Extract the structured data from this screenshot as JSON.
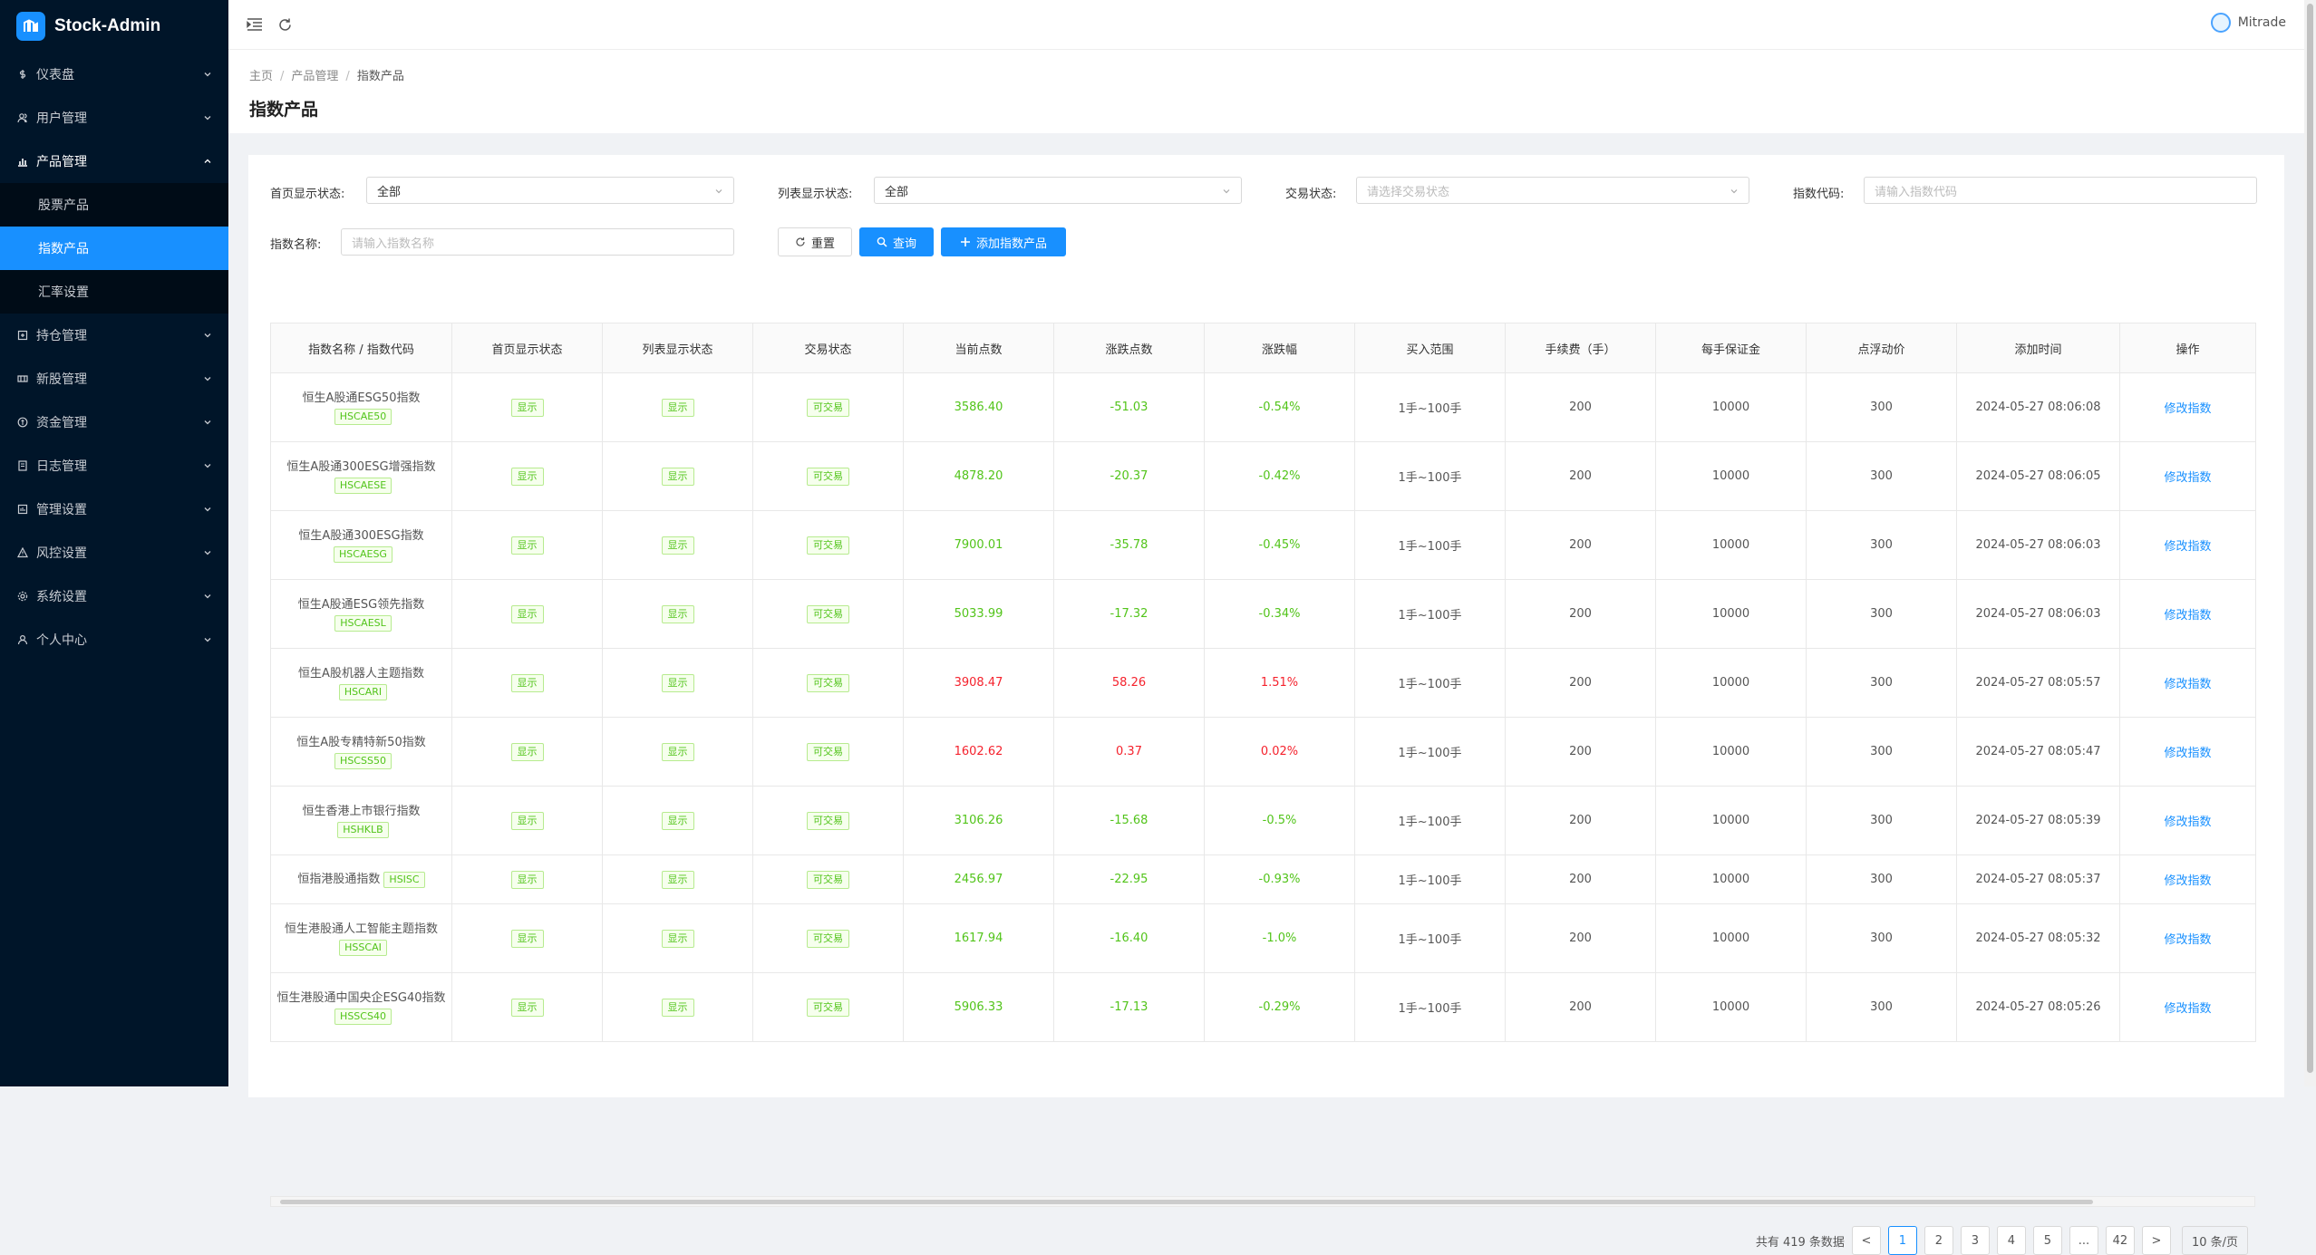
{
  "app": {
    "title": "Stock-Admin",
    "user": "Mitrade"
  },
  "sidebar": {
    "items": [
      {
        "label": "仪表盘"
      },
      {
        "label": "用户管理"
      },
      {
        "label": "产品管理"
      },
      {
        "label": "持仓管理"
      },
      {
        "label": "新股管理"
      },
      {
        "label": "资金管理"
      },
      {
        "label": "日志管理"
      },
      {
        "label": "管理设置"
      },
      {
        "label": "风控设置"
      },
      {
        "label": "系统设置"
      },
      {
        "label": "个人中心"
      }
    ],
    "sub_items": [
      {
        "label": "股票产品"
      },
      {
        "label": "指数产品"
      },
      {
        "label": "汇率设置"
      }
    ]
  },
  "breadcrumb": {
    "home": "主页",
    "parent": "产品管理",
    "current": "指数产品"
  },
  "page_title": "指数产品",
  "filters": {
    "home_display_label": "首页显示状态:",
    "home_display_value": "全部",
    "list_display_label": "列表显示状态:",
    "list_display_value": "全部",
    "trade_status_label": "交易状态:",
    "trade_status_placeholder": "请选择交易状态",
    "index_code_label": "指数代码:",
    "index_code_placeholder": "请输入指数代码",
    "index_name_label": "指数名称:",
    "index_name_placeholder": "请输入指数名称",
    "reset_label": "重置",
    "search_label": "查询",
    "add_label": "添加指数产品"
  },
  "table": {
    "headers": [
      "指数名称 / 指数代码",
      "首页显示状态",
      "列表显示状态",
      "交易状态",
      "当前点数",
      "涨跌点数",
      "涨跌幅",
      "买入范围",
      "手续费（手）",
      "每手保证金",
      "点浮动价",
      "添加时间",
      "操作"
    ],
    "rows": [
      {
        "name": "恒生A股通ESG50指数",
        "code": "HSCAE50",
        "home": "显示",
        "list": "显示",
        "trade": "可交易",
        "price": "3586.40",
        "change": "-51.03",
        "pct": "-0.54%",
        "range": "1手~100手",
        "fee": "200",
        "margin": "10000",
        "float": "300",
        "time": "2024-05-27 08:06:08",
        "action": "修改指数",
        "dir": "down"
      },
      {
        "name": "恒生A股通300ESG增强指数",
        "code": "HSCAESE",
        "home": "显示",
        "list": "显示",
        "trade": "可交易",
        "price": "4878.20",
        "change": "-20.37",
        "pct": "-0.42%",
        "range": "1手~100手",
        "fee": "200",
        "margin": "10000",
        "float": "300",
        "time": "2024-05-27 08:06:05",
        "action": "修改指数",
        "dir": "down"
      },
      {
        "name": "恒生A股通300ESG指数",
        "code": "HSCAESG",
        "home": "显示",
        "list": "显示",
        "trade": "可交易",
        "price": "7900.01",
        "change": "-35.78",
        "pct": "-0.45%",
        "range": "1手~100手",
        "fee": "200",
        "margin": "10000",
        "float": "300",
        "time": "2024-05-27 08:06:03",
        "action": "修改指数",
        "dir": "down"
      },
      {
        "name": "恒生A股通ESG领先指数",
        "code": "HSCAESL",
        "home": "显示",
        "list": "显示",
        "trade": "可交易",
        "price": "5033.99",
        "change": "-17.32",
        "pct": "-0.34%",
        "range": "1手~100手",
        "fee": "200",
        "margin": "10000",
        "float": "300",
        "time": "2024-05-27 08:06:03",
        "action": "修改指数",
        "dir": "down"
      },
      {
        "name": "恒生A股机器人主题指数",
        "code": "HSCARI",
        "home": "显示",
        "list": "显示",
        "trade": "可交易",
        "price": "3908.47",
        "change": "58.26",
        "pct": "1.51%",
        "range": "1手~100手",
        "fee": "200",
        "margin": "10000",
        "float": "300",
        "time": "2024-05-27 08:05:57",
        "action": "修改指数",
        "dir": "up"
      },
      {
        "name": "恒生A股专精特新50指数",
        "code": "HSCSS50",
        "home": "显示",
        "list": "显示",
        "trade": "可交易",
        "price": "1602.62",
        "change": "0.37",
        "pct": "0.02%",
        "range": "1手~100手",
        "fee": "200",
        "margin": "10000",
        "float": "300",
        "time": "2024-05-27 08:05:47",
        "action": "修改指数",
        "dir": "up"
      },
      {
        "name": "恒生香港上市银行指数",
        "code": "HSHKLB",
        "home": "显示",
        "list": "显示",
        "trade": "可交易",
        "price": "3106.26",
        "change": "-15.68",
        "pct": "-0.5%",
        "range": "1手~100手",
        "fee": "200",
        "margin": "10000",
        "float": "300",
        "time": "2024-05-27 08:05:39",
        "action": "修改指数",
        "dir": "down"
      },
      {
        "name": "恒指港股通指数",
        "code": "HSISC",
        "home": "显示",
        "list": "显示",
        "trade": "可交易",
        "price": "2456.97",
        "change": "-22.95",
        "pct": "-0.93%",
        "range": "1手~100手",
        "fee": "200",
        "margin": "10000",
        "float": "300",
        "time": "2024-05-27 08:05:37",
        "action": "修改指数",
        "dir": "down"
      },
      {
        "name": "恒生港股通人工智能主题指数",
        "code": "HSSCAI",
        "home": "显示",
        "list": "显示",
        "trade": "可交易",
        "price": "1617.94",
        "change": "-16.40",
        "pct": "-1.0%",
        "range": "1手~100手",
        "fee": "200",
        "margin": "10000",
        "float": "300",
        "time": "2024-05-27 08:05:32",
        "action": "修改指数",
        "dir": "down"
      },
      {
        "name": "恒生港股通中国央企ESG40指数",
        "code": "HSSCS40",
        "home": "显示",
        "list": "显示",
        "trade": "可交易",
        "price": "5906.33",
        "change": "-17.13",
        "pct": "-0.29%",
        "range": "1手~100手",
        "fee": "200",
        "margin": "10000",
        "float": "300",
        "time": "2024-05-27 08:05:26",
        "action": "修改指数",
        "dir": "down"
      }
    ]
  },
  "pagination": {
    "total_text": "共有 419 条数据",
    "pages": [
      "<",
      "1",
      "2",
      "3",
      "4",
      "5",
      "...",
      "42",
      ">"
    ],
    "current": "1",
    "page_size": "10 条/页"
  },
  "colors": {
    "primary": "#1890ff",
    "sidebar_bg": "#001529",
    "up": "#f5222d",
    "down": "#52c41a"
  }
}
